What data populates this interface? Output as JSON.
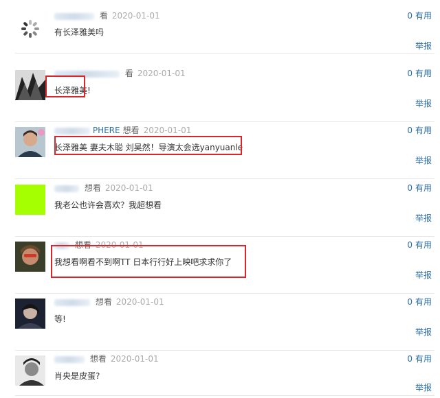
{
  "comments": [
    {
      "user": "",
      "status": "看",
      "date": "2020-01-01",
      "text": "有长泽雅美吗",
      "useful_count": "0",
      "useful_label": "有用",
      "report_label": "举报"
    },
    {
      "user": "",
      "status": "看",
      "date": "2020-01-01",
      "text": "长泽雅美!",
      "useful_count": "0",
      "useful_label": "有用",
      "report_label": "举报"
    },
    {
      "user": "PHERE",
      "status": "想看",
      "date": "2020-01-01",
      "text": "长泽雅美 妻夫木聪 刘昊然！导演太会选yanyuanle",
      "useful_count": "0",
      "useful_label": "有用",
      "report_label": "举报"
    },
    {
      "user": "",
      "status": "想看",
      "date": "2020-01-01",
      "text": "我老公也许会喜欢？我超想看",
      "useful_count": "0",
      "useful_label": "有用",
      "report_label": "举报"
    },
    {
      "user": "",
      "status": "想看",
      "date": "2020-01-01",
      "text": "我想看啊看不到啊TT 日本行行好上映吧求求你了",
      "useful_count": "0",
      "useful_label": "有用",
      "report_label": "举报"
    },
    {
      "user": "",
      "status": "想看",
      "date": "2020-01-01",
      "text": "等!",
      "useful_count": "0",
      "useful_label": "有用",
      "report_label": "举报"
    },
    {
      "user": "",
      "status": "想看",
      "date": "2020-01-01",
      "text": "肖央是皮蛋?",
      "useful_count": "0",
      "useful_label": "有用",
      "report_label": "举报"
    }
  ],
  "colors": {
    "link": "#2b6ea6",
    "highlight": "#d9252a",
    "divider": "#e6e6e6",
    "text": "#333333"
  }
}
